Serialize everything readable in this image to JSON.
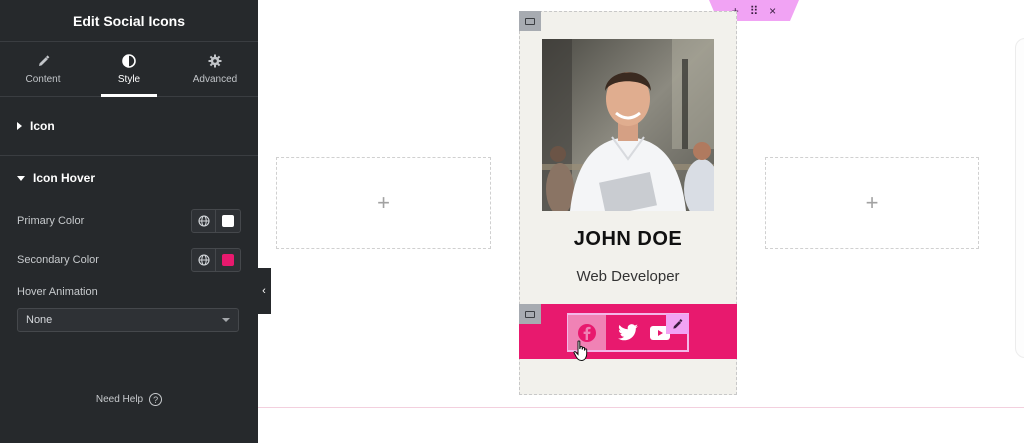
{
  "panel": {
    "title": "Edit Social Icons",
    "tabs": [
      {
        "label": "Content",
        "icon": "pencil-icon"
      },
      {
        "label": "Style",
        "icon": "half-circle-icon",
        "active": true
      },
      {
        "label": "Advanced",
        "icon": "gear-icon"
      }
    ],
    "sections": {
      "icon": {
        "label": "Icon",
        "expanded": false
      },
      "icon_hover": {
        "label": "Icon Hover",
        "expanded": true
      }
    },
    "controls": {
      "primary_color": {
        "label": "Primary Color",
        "value": "#ffffff"
      },
      "secondary_color": {
        "label": "Secondary Color",
        "value": "#e8196e"
      },
      "hover_animation": {
        "label": "Hover Animation",
        "value": "None"
      }
    },
    "help": {
      "label": "Need Help",
      "icon": "question-circle-icon"
    }
  },
  "canvas": {
    "section_toolbar": {
      "add": "+",
      "drag": "⠿",
      "close": "×"
    },
    "placeholder_symbol": "+",
    "card": {
      "name": "JOHN DOE",
      "role": "Web Developer",
      "social_bar_color": "#e8196e",
      "social_icons": [
        "facebook-icon",
        "twitter-icon",
        "youtube-icon"
      ]
    }
  }
}
